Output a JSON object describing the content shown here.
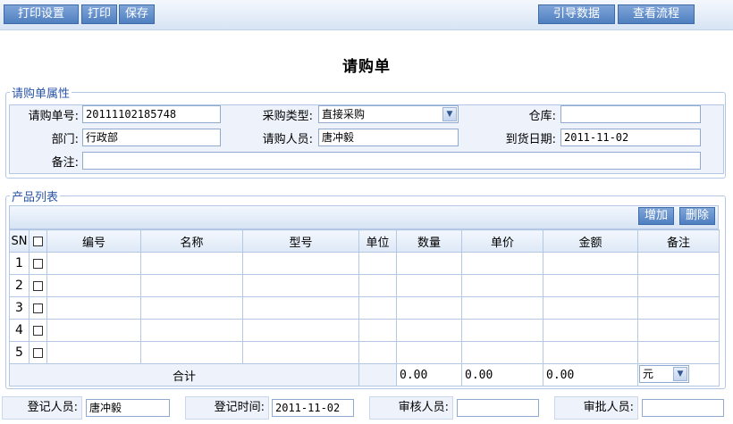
{
  "toolbar": {
    "print_settings": "打印设置",
    "print": "打印",
    "save": "保存",
    "import_data": "引导数据",
    "view_flow": "查看流程"
  },
  "page": {
    "title": "请购单"
  },
  "attributes": {
    "legend": "请购单属性",
    "order_no_label": "请购单号:",
    "order_no": "20111102185748",
    "purchase_type_label": "采购类型:",
    "purchase_type": "直接采购",
    "warehouse_label": "仓库:",
    "warehouse": "",
    "department_label": "部门:",
    "department": "行政部",
    "requester_label": "请购人员:",
    "requester": "唐冲毅",
    "arrival_date_label": "到货日期:",
    "arrival_date": "2011-11-02",
    "remarks_label": "备注:",
    "remarks": ""
  },
  "products": {
    "legend": "产品列表",
    "add_button": "增加",
    "delete_button": "删除",
    "columns": [
      "SN",
      "编号",
      "名称",
      "型号",
      "单位",
      "数量",
      "单价",
      "金额",
      "备注"
    ],
    "rows": [
      {
        "sn": "1"
      },
      {
        "sn": "2"
      },
      {
        "sn": "3"
      },
      {
        "sn": "4"
      },
      {
        "sn": "5"
      }
    ],
    "total_label": "合计",
    "total_quantity": "0.00",
    "total_unit_price": "0.00",
    "total_amount": "0.00",
    "currency": "元"
  },
  "footer": {
    "registrar_label": "登记人员:",
    "registrar": "唐冲毅",
    "register_time_label": "登记时间:",
    "register_time": "2011-11-02",
    "reviewer_label": "审核人员:",
    "reviewer": "",
    "approver_label": "审批人员:",
    "approver": ""
  },
  "colors": {
    "accent": "#4f7fc0",
    "border": "#b4c8e6",
    "legend": "#2a55a8"
  }
}
